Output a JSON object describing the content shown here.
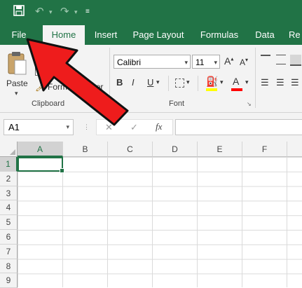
{
  "title_bar": {
    "icons": [
      "save-icon",
      "undo-icon",
      "redo-icon",
      "customize-quick-access-icon"
    ]
  },
  "tabs": [
    {
      "label": "File"
    },
    {
      "label": "Home"
    },
    {
      "label": "Insert"
    },
    {
      "label": "Page Layout"
    },
    {
      "label": "Formulas"
    },
    {
      "label": "Data"
    },
    {
      "label": "Re"
    }
  ],
  "clipboard": {
    "paste_label": "Paste",
    "copy_label": "Copy",
    "format_painter_label": "Format Painter",
    "group_label": "Clipboard"
  },
  "font": {
    "name": "Calibri",
    "size": "11",
    "bold": "B",
    "italic": "I",
    "underline": "U",
    "group_label": "Font",
    "colors": {
      "highlight": "#ffff00",
      "font_color": "#ff0000"
    }
  },
  "formula_bar": {
    "name_box": "A1",
    "cancel": "✕",
    "enter": "✓",
    "fx": "fx",
    "value": ""
  },
  "sheet": {
    "columns": [
      "A",
      "B",
      "C",
      "D",
      "E",
      "F"
    ],
    "rows": [
      "1",
      "2",
      "3",
      "4",
      "5",
      "6",
      "7",
      "8",
      "9"
    ],
    "active_cell": "A1"
  },
  "annotation": {
    "color": "#ee1c1c",
    "outline": "#111111"
  }
}
